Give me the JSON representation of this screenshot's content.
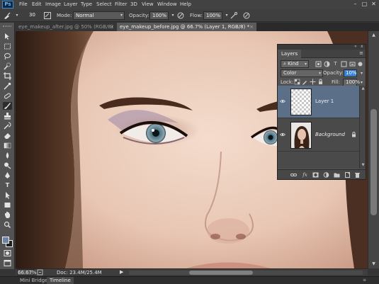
{
  "app": {
    "logo": "Ps"
  },
  "menu": [
    "File",
    "Edit",
    "Image",
    "Layer",
    "Type",
    "Select",
    "Filter",
    "3D",
    "View",
    "Window",
    "Help"
  ],
  "window_controls": {
    "minimize": "–",
    "maximize": "□",
    "close": "✕"
  },
  "options_bar": {
    "brush_size": "30",
    "mode_label": "Mode:",
    "mode_value": "Normal",
    "opacity_label": "Opacity:",
    "opacity_value": "100%",
    "flow_label": "Flow:",
    "flow_value": "100%"
  },
  "document_tabs": [
    {
      "label": "eye_makeup_after.jpg @ 50% (RGB/8)",
      "close": "×",
      "active": false
    },
    {
      "label": "eye_makeup_before.jpg @ 66.7% (Layer 1, RGB/8) *",
      "close": "×",
      "active": true
    }
  ],
  "layers_panel": {
    "title": "Layers",
    "collapse": "«",
    "close": "x",
    "menu": "≡",
    "filter_kind": "Kind",
    "blend_mode": "Color",
    "opacity_label": "Opacity:",
    "opacity_value": "10%",
    "lock_label": "Lock:",
    "fill_label": "Fill:",
    "fill_value": "100%",
    "layers": [
      {
        "name": "Layer 1",
        "visible": true,
        "selected": true,
        "locked": false
      },
      {
        "name": "Background",
        "visible": true,
        "selected": false,
        "locked": true
      }
    ]
  },
  "status_bar": {
    "zoom": "66.67%",
    "doc_info": "Doc: 23.4M/25.4M",
    "arrow": "▶"
  },
  "bottom_tabs": [
    "Mini Bridge",
    "Timeline"
  ],
  "colors": {
    "foreground": "#6f84a4",
    "background": "#1f1f1f",
    "selected_layer": "#5b7088",
    "accent": "#3a80d0"
  }
}
